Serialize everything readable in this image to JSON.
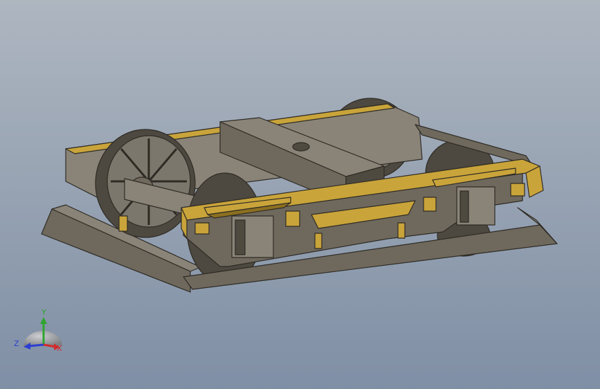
{
  "viewport": {
    "background_top": "#aeb6c0",
    "background_bottom": "#7f8fa5",
    "model_name": "bogie-assembly"
  },
  "colors": {
    "frame_light": "#8a8478",
    "frame_mid": "#6f695d",
    "frame_dark": "#4f4a40",
    "brass": "#c9a43a",
    "brass_dark": "#8c7020",
    "wheel": "#7c776c",
    "wheel_dark": "#4d4940",
    "edge": "#2e2b25"
  },
  "triad": {
    "x_label": "X",
    "y_label": "Y",
    "z_label": "Z",
    "x_color": "#d22b2b",
    "y_color": "#2fa52f",
    "z_color": "#2b3fd2"
  }
}
